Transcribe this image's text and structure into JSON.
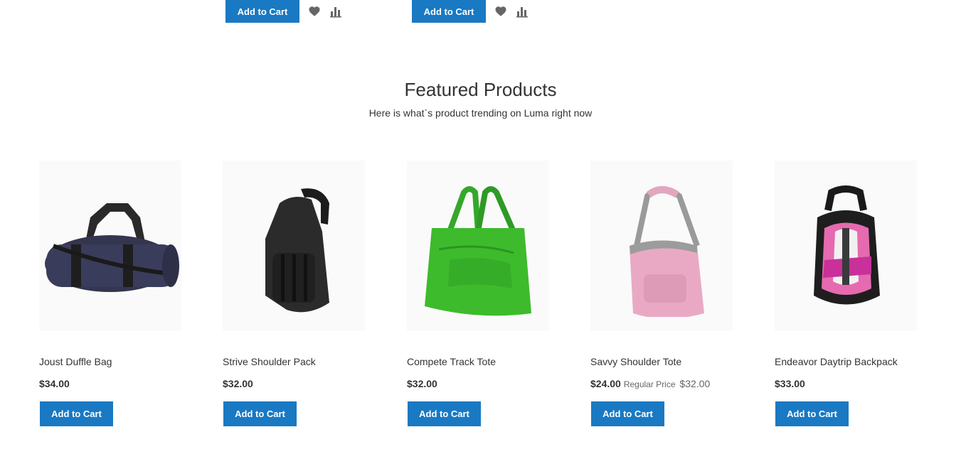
{
  "top": {
    "buttons": [
      {
        "label": "Add to Cart"
      },
      {
        "label": "Add to Cart"
      }
    ]
  },
  "section": {
    "title": "Featured Products",
    "subtitle": "Here is what`s product trending on Luma right now"
  },
  "products": [
    {
      "name": "Joust Duffle Bag",
      "price": "$34.00",
      "button": "Add to Cart",
      "image": "duffle-bag-image"
    },
    {
      "name": "Strive Shoulder Pack",
      "price": "$32.00",
      "button": "Add to Cart",
      "image": "shoulder-pack-image"
    },
    {
      "name": "Compete Track Tote",
      "price": "$32.00",
      "button": "Add to Cart",
      "image": "track-tote-image"
    },
    {
      "name": "Savvy Shoulder Tote",
      "price": "$24.00",
      "regular_label": "Regular Price",
      "regular_price": "$32.00",
      "button": "Add to Cart",
      "image": "shoulder-tote-image"
    },
    {
      "name": "Endeavor Daytrip Backpack",
      "price": "$33.00",
      "button": "Add to Cart",
      "image": "backpack-image"
    }
  ],
  "colors": {
    "accent": "#1979c3",
    "text": "#333333",
    "muted": "#666666"
  }
}
